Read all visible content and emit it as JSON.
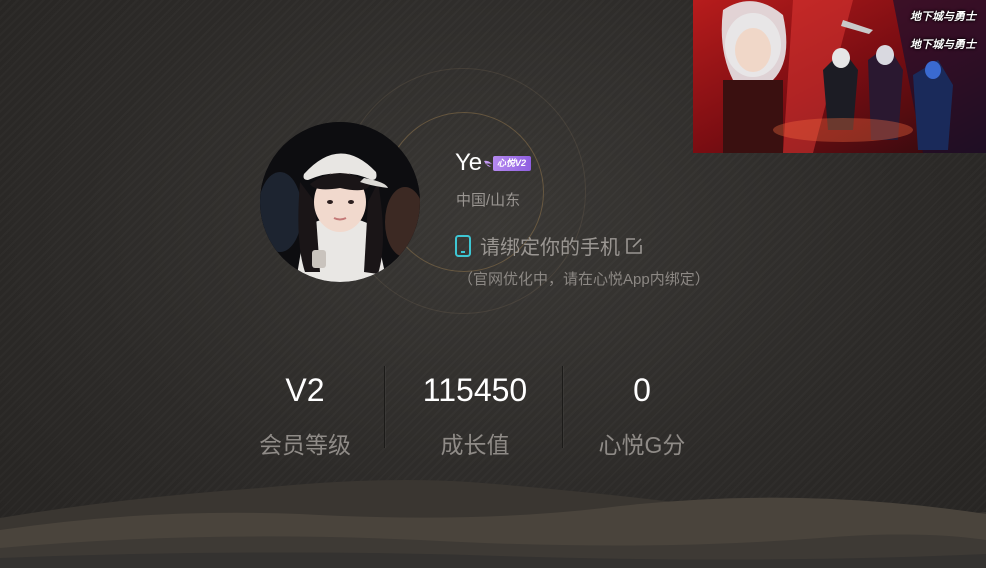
{
  "profile": {
    "username": "Ye",
    "vip_badge": "心悦V2",
    "location": "中国/山东",
    "bind_phone_text": "请绑定你的手机",
    "bind_phone_note": "（官网优化中，请在心悦App内绑定）"
  },
  "stats": [
    {
      "value": "V2",
      "label": "会员等级"
    },
    {
      "value": "115450",
      "label": "成长值"
    },
    {
      "value": "0",
      "label": "心悦G分"
    }
  ],
  "ad": {
    "game_logo": "地下城与勇士"
  },
  "colors": {
    "background": "#2f2d2b",
    "accent_cyan": "#3ec6d3",
    "vip_purple": "#a574ea",
    "muted_text": "#9a9692"
  },
  "icons": {
    "phone": "phone-icon",
    "edit": "edit-icon",
    "vip_wing": "wing-icon"
  }
}
